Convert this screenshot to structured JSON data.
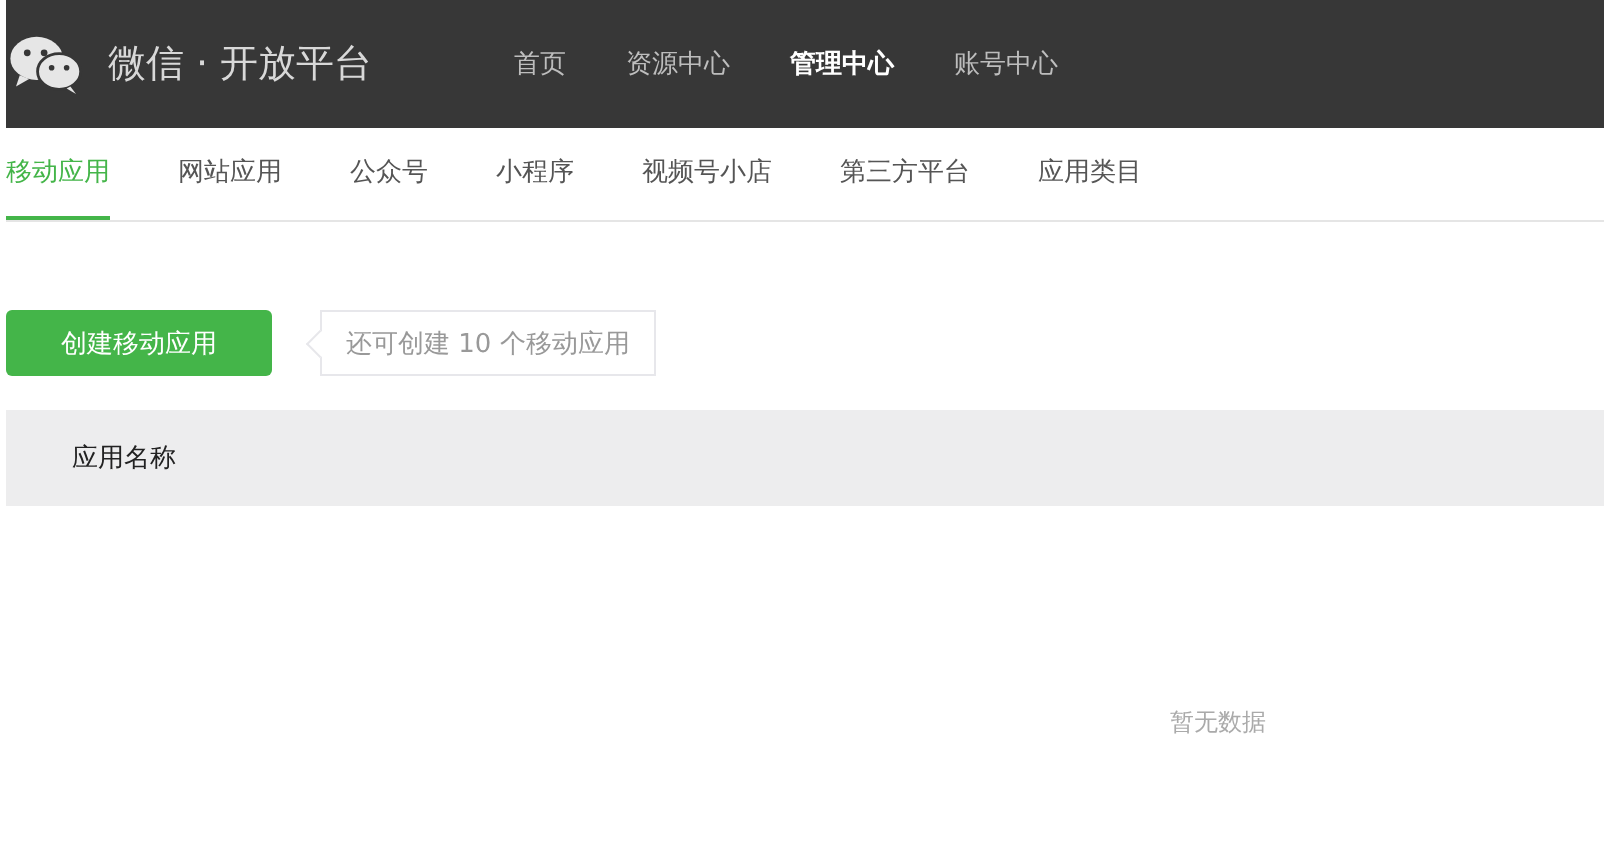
{
  "header": {
    "title": "微信 · 开放平台",
    "nav": [
      {
        "label": "首页",
        "selected": false
      },
      {
        "label": "资源中心",
        "selected": false
      },
      {
        "label": "管理中心",
        "selected": true
      },
      {
        "label": "账号中心",
        "selected": false
      }
    ]
  },
  "tabs": [
    {
      "label": "移动应用",
      "selected": true
    },
    {
      "label": "网站应用",
      "selected": false
    },
    {
      "label": "公众号",
      "selected": false
    },
    {
      "label": "小程序",
      "selected": false
    },
    {
      "label": "视频号小店",
      "selected": false
    },
    {
      "label": "第三方平台",
      "selected": false
    },
    {
      "label": "应用类目",
      "selected": false
    }
  ],
  "create_button": "创建移动应用",
  "quota_tip": "还可创建 10 个移动应用",
  "table": {
    "columns": [
      "应用名称"
    ],
    "empty_text": "暂无数据"
  }
}
